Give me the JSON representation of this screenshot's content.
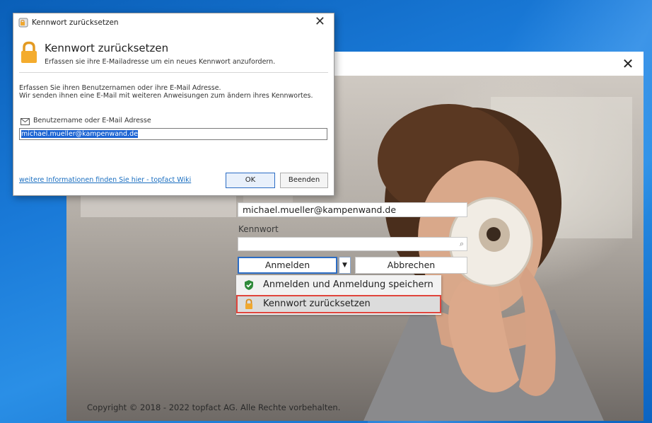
{
  "reset_dialog": {
    "title": "Kennwort zurücksetzen",
    "heading": "Kennwort zurücksetzen",
    "subheading": "Erfassen sie ihre E-Mailadresse um ein neues Kennwort anzufordern.",
    "info_line1": "Erfassen Sie ihren Benutzernamen oder ihre E-Mail Adresse.",
    "info_line2": "Wir senden ihnen eine E-Mail mit weiteren Anweisungen zum ändern ihres Kennwortes.",
    "field_label": "Benutzername oder E-Mail Adresse",
    "field_value": "michael.mueller@kampenwand.de",
    "link_text": "weitere Informationen finden Sie hier - topfact Wiki",
    "ok_label": "OK",
    "exit_label": "Beenden",
    "close_glyph": "✕"
  },
  "login": {
    "close_glyph": "✕",
    "username_value": "michael.mueller@kampenwand.de",
    "password_label": "Kennwort",
    "password_value": "",
    "login_button": "Anmelden",
    "cancel_button": "Abbrechen",
    "dropdown_arrow": "▼",
    "dropdown_items": [
      {
        "label": "Anmelden und Anmeldung speichern",
        "icon": "shield-check-icon"
      },
      {
        "label": "Kennwort zurücksetzen",
        "icon": "lock-icon"
      }
    ],
    "copyright": "Copyright © 2018 - 2022 topfact AG. Alle Rechte vorbehalten."
  },
  "colors": {
    "accent": "#2b6cc4",
    "highlight_border": "#e0453c",
    "desktop_blue": "#1a7ad8"
  }
}
